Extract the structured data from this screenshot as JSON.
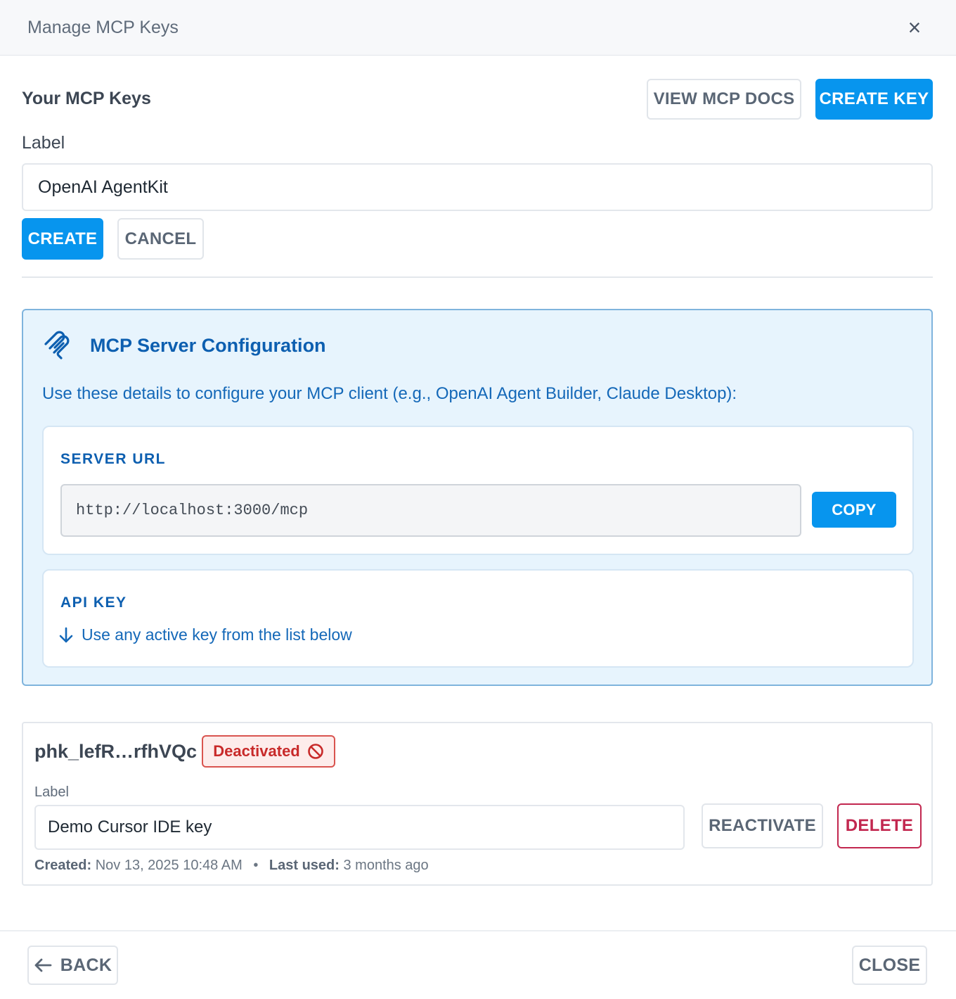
{
  "modal": {
    "title": "Manage MCP Keys",
    "close_icon": "close-icon"
  },
  "keys_section": {
    "title": "Your MCP Keys",
    "view_docs_label": "VIEW MCP DOCS",
    "create_key_label": "CREATE KEY"
  },
  "new_key_form": {
    "label": "Label",
    "value": "OpenAI AgentKit",
    "create_label": "CREATE",
    "cancel_label": "CANCEL"
  },
  "config": {
    "icon": "mcp-logo-icon",
    "title": "MCP Server Configuration",
    "description": "Use these details to configure your MCP client (e.g., OpenAI Agent Builder, Claude Desktop):",
    "server_url_label": "SERVER URL",
    "server_url": "http://localhost:3000/mcp",
    "copy_label": "COPY",
    "api_key_label": "API KEY",
    "api_key_hint": "Use any active key from the list below",
    "api_key_hint_icon": "arrow-down-icon"
  },
  "keys": [
    {
      "id": "phk_lefR…rfhVQc",
      "status": "Deactivated",
      "status_icon": "prohibited-icon",
      "label_caption": "Label",
      "label_value": "Demo Cursor IDE key",
      "reactivate_label": "REACTIVATE",
      "delete_label": "DELETE",
      "created_caption": "Created:",
      "created_value": "Nov 13, 2025 10:48 AM",
      "separator": "•",
      "last_used_caption": "Last used:",
      "last_used_value": "3 months ago"
    }
  ],
  "footer": {
    "back_label": "BACK",
    "back_icon": "arrow-left-icon",
    "close_label": "CLOSE"
  },
  "colors": {
    "primary": "#0795ee",
    "config_bg": "#e7f4fd",
    "config_text": "#0d5fb0",
    "danger": "#c2274f",
    "deactivated": "#c82a2a"
  }
}
